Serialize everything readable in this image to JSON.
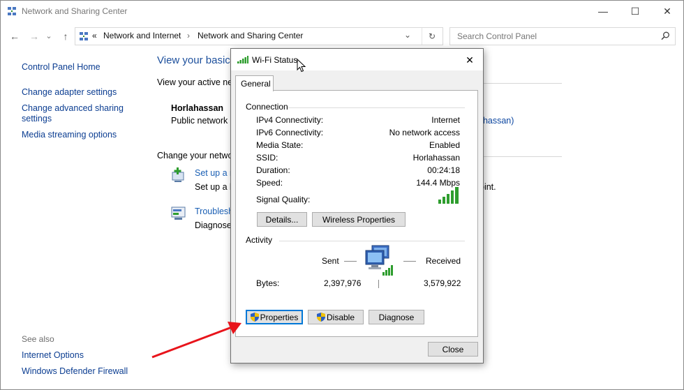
{
  "window": {
    "title": "Network and Sharing Center",
    "minimize_glyph": "—",
    "maximize_glyph": "☐",
    "close_glyph": "✕"
  },
  "nav": {
    "back_glyph": "←",
    "forward_glyph": "→",
    "recent_glyph": "⌄",
    "up_glyph": "↑",
    "address_chevrons": "«",
    "breadcrumb": [
      "Network and Internet",
      "Network and Sharing Center"
    ],
    "breadcrumb_separator": "›",
    "address_dropdown_glyph": "⌄",
    "refresh_glyph": "↻",
    "search_placeholder": "Search Control Panel"
  },
  "sidebar": {
    "home": "Control Panel Home",
    "items": [
      "Change adapter settings",
      "Change advanced sharing",
      "settings",
      "Media streaming options"
    ],
    "see_also_label": "See also",
    "see_also": [
      "Internet Options",
      "Windows Defender Firewall"
    ]
  },
  "main": {
    "title": "View your basic",
    "active_networks": "View your active netw",
    "network_name": "Horlahassan",
    "network_type": "Public network",
    "connection_partial": "ahassan)",
    "change_settings": "Change your netwo",
    "setup_link": "Set up a n",
    "setup_desc": "Set up a b",
    "setup_desc_tail": "oint.",
    "troubleshoot_link": "Troublesh",
    "troubleshoot_desc": "Diagnose"
  },
  "dialog": {
    "title": "Wi-Fi Status",
    "close_glyph": "✕",
    "tab": "General",
    "connection_group": "Connection",
    "rows": [
      {
        "label": "IPv4 Connectivity:",
        "value": "Internet"
      },
      {
        "label": "IPv6 Connectivity:",
        "value": "No network access"
      },
      {
        "label": "Media State:",
        "value": "Enabled"
      },
      {
        "label": "SSID:",
        "value": "Horlahassan"
      },
      {
        "label": "Duration:",
        "value": "00:24:18"
      },
      {
        "label": "Speed:",
        "value": "144.4 Mbps"
      }
    ],
    "signal_label": "Signal Quality:",
    "details_button": "Details...",
    "wireless_button": "Wireless Properties",
    "activity_group": "Activity",
    "sent_label": "Sent",
    "received_label": "Received",
    "bytes_label": "Bytes:",
    "bytes_sent": "2,397,976",
    "bytes_received": "3,579,922",
    "properties_button": "Properties",
    "disable_button": "Disable",
    "diagnose_button": "Diagnose",
    "close_button": "Close"
  },
  "colors": {
    "link": "#0b3d91",
    "heading": "#1c4f9c",
    "signal": "#2e9d2e",
    "arrow": "#e8141b"
  }
}
